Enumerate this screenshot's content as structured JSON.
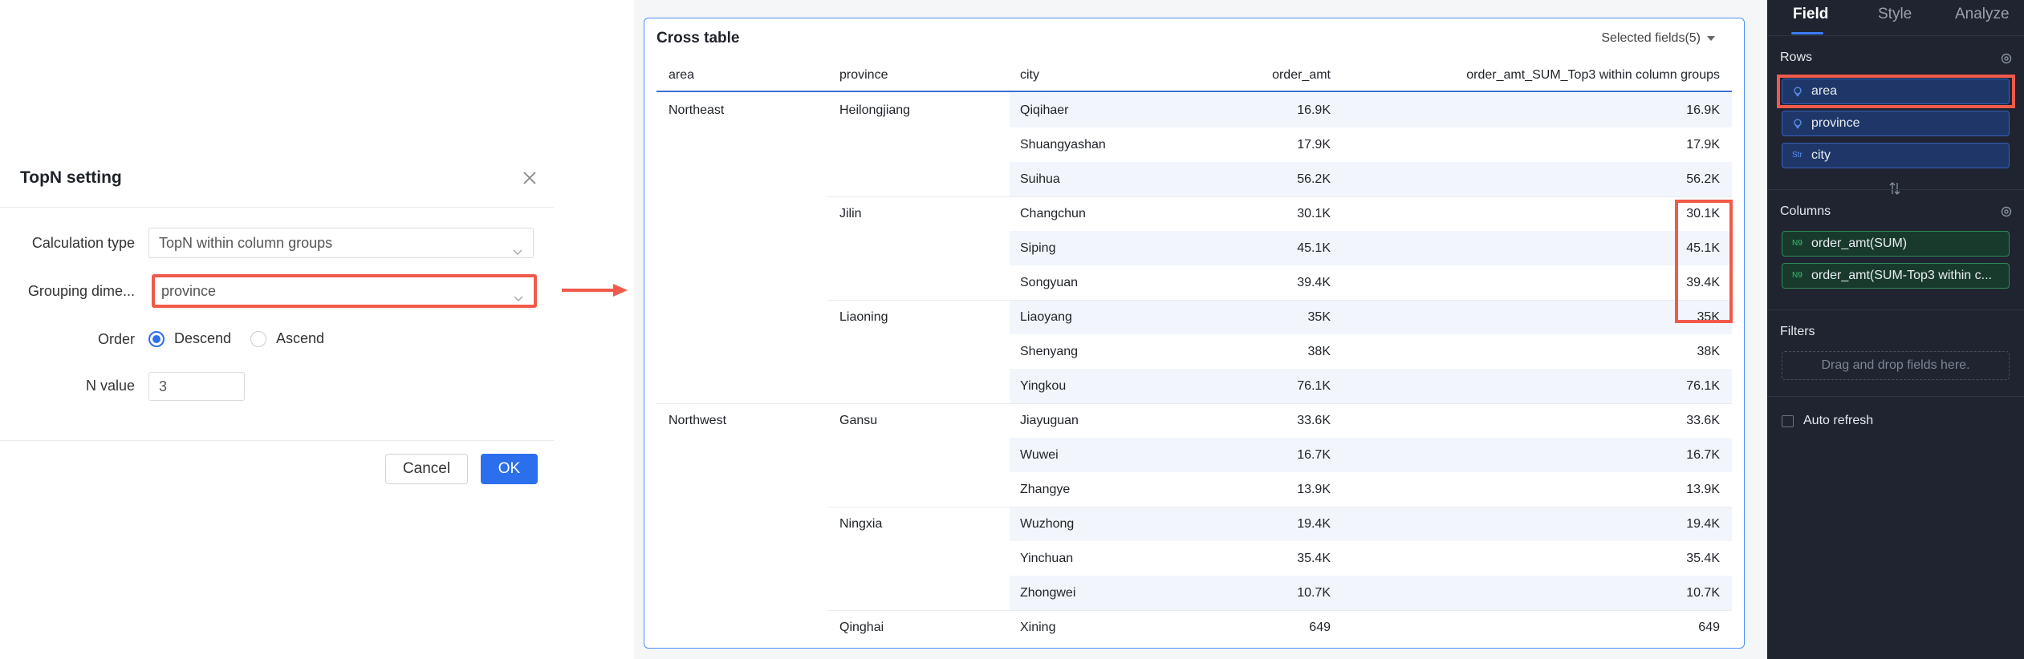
{
  "dialog": {
    "title": "TopN setting",
    "calc_type_label": "Calculation type",
    "calc_type_value": "TopN within column groups",
    "group_dim_label": "Grouping dime...",
    "group_dim_value": "province",
    "order_label": "Order",
    "order_options": [
      "Descend",
      "Ascend"
    ],
    "order_selected": "Descend",
    "n_label": "N value",
    "n_value": "3",
    "cancel_label": "Cancel",
    "ok_label": "OK"
  },
  "table": {
    "title": "Cross table",
    "selected_fields": "Selected fields(5)",
    "columns": [
      "area",
      "province",
      "city",
      "order_amt",
      "order_amt_SUM_Top3 within column groups"
    ],
    "rows": [
      {
        "area": "Northeast",
        "province": "Heilongjiang",
        "city": "Qiqihaer",
        "amt": "16.9K",
        "top3": "16.9K"
      },
      {
        "area": "",
        "province": "",
        "city": "Shuangyashan",
        "amt": "17.9K",
        "top3": "17.9K"
      },
      {
        "area": "",
        "province": "",
        "city": "Suihua",
        "amt": "56.2K",
        "top3": "56.2K"
      },
      {
        "area": "",
        "province": "Jilin",
        "city": "Changchun",
        "amt": "30.1K",
        "top3": "30.1K"
      },
      {
        "area": "",
        "province": "",
        "city": "Siping",
        "amt": "45.1K",
        "top3": "45.1K"
      },
      {
        "area": "",
        "province": "",
        "city": "Songyuan",
        "amt": "39.4K",
        "top3": "39.4K"
      },
      {
        "area": "",
        "province": "Liaoning",
        "city": "Liaoyang",
        "amt": "35K",
        "top3": "35K"
      },
      {
        "area": "",
        "province": "",
        "city": "Shenyang",
        "amt": "38K",
        "top3": "38K"
      },
      {
        "area": "",
        "province": "",
        "city": "Yingkou",
        "amt": "76.1K",
        "top3": "76.1K"
      },
      {
        "area": "Northwest",
        "province": "Gansu",
        "city": "Jiayuguan",
        "amt": "33.6K",
        "top3": "33.6K"
      },
      {
        "area": "",
        "province": "",
        "city": "Wuwei",
        "amt": "16.7K",
        "top3": "16.7K"
      },
      {
        "area": "",
        "province": "",
        "city": "Zhangye",
        "amt": "13.9K",
        "top3": "13.9K"
      },
      {
        "area": "",
        "province": "Ningxia",
        "city": "Wuzhong",
        "amt": "19.4K",
        "top3": "19.4K"
      },
      {
        "area": "",
        "province": "",
        "city": "Yinchuan",
        "amt": "35.4K",
        "top3": "35.4K"
      },
      {
        "area": "",
        "province": "",
        "city": "Zhongwei",
        "amt": "10.7K",
        "top3": "10.7K"
      },
      {
        "area": "",
        "province": "Qinghai",
        "city": "Xining",
        "amt": "649",
        "top3": "649"
      }
    ]
  },
  "panel": {
    "tabs": [
      "Field",
      "Style",
      "Analyze"
    ],
    "active_tab": "Field",
    "rows_title": "Rows",
    "rows_fields": [
      {
        "label": "area",
        "icon": "location-icon"
      },
      {
        "label": "province",
        "icon": "location-icon"
      },
      {
        "label": "city",
        "icon": "text-dimension-icon",
        "glyph": "Str"
      }
    ],
    "columns_title": "Columns",
    "columns_fields": [
      {
        "label": "order_amt(SUM)",
        "glyph": "N9"
      },
      {
        "label": "order_amt(SUM-Top3 within c...",
        "glyph": "N9"
      }
    ],
    "filters_title": "Filters",
    "filters_placeholder": "Drag and drop fields here.",
    "auto_refresh": "Auto refresh"
  },
  "colors": {
    "accent": "#2b6fed",
    "highlight": "#f15a4a",
    "panel_bg": "#1f2430"
  }
}
